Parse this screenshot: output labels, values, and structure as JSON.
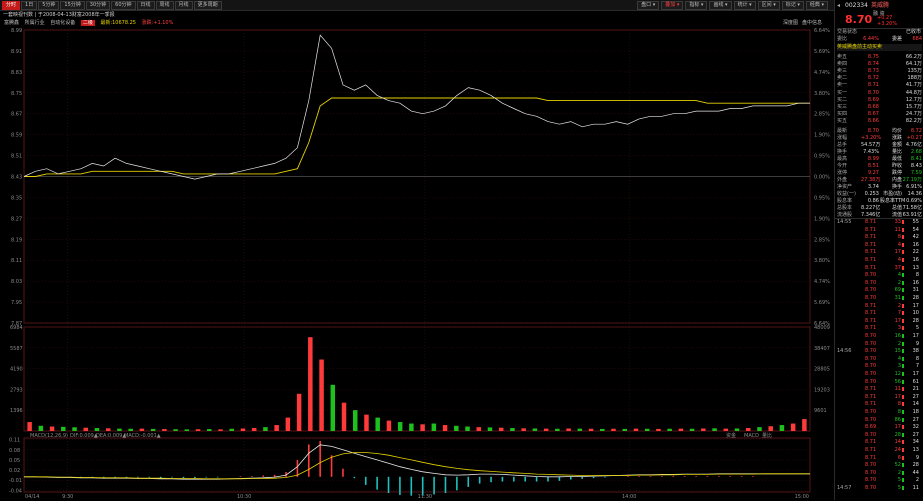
{
  "toolbar": {
    "left": [
      "分时",
      "1日",
      "5分钟",
      "15分钟",
      "30分钟",
      "60分钟",
      "日线",
      "周线",
      "月线",
      "更多周期"
    ],
    "right": [
      "盘口",
      "叠加",
      "指标",
      "画线",
      "统计",
      "区间",
      "标记",
      "经典"
    ]
  },
  "title": "一套映视刊数 | 于2008-04-13财富2008年一季报",
  "info": {
    "left1": "富腾鑫",
    "left2": "所属行业",
    "left3": "自动化设备",
    "tag": "二级",
    "amount": "最新:10678.25",
    "change": "涨跌:+1.10%",
    "right1": "深度图",
    "right2": "盘中信息"
  },
  "chart_data": [
    {
      "type": "line",
      "title": "",
      "time_ticks": [
        "04/14",
        "9:30",
        "10:30",
        "11:30",
        "14:00",
        "15:00"
      ],
      "y_left_ticks": [
        "8.99",
        "8.91",
        "8.83",
        "8.75",
        "8.67",
        "8.59",
        "8.51",
        "8.43",
        "8.35",
        "8.27",
        "8.19",
        "8.11",
        "8.03",
        "7.95",
        "7.87"
      ],
      "y_right_ticks": [
        "6.64%",
        "5.69%",
        "4.74%",
        "3.80%",
        "2.85%",
        "1.90%",
        "0.95%",
        "0.00%",
        "0.95%",
        "1.90%",
        "2.85%",
        "3.80%",
        "4.74%",
        "5.69%",
        "6.64%"
      ],
      "ylim": [
        7.87,
        8.99
      ],
      "prev_close": 8.43,
      "series": [
        {
          "name": "price",
          "values": [
            8.43,
            8.45,
            8.46,
            8.44,
            8.45,
            8.46,
            8.48,
            8.47,
            8.5,
            8.48,
            8.47,
            8.46,
            8.45,
            8.44,
            8.43,
            8.42,
            8.43,
            8.44,
            8.44,
            8.45,
            8.46,
            8.47,
            8.48,
            8.5,
            8.54,
            8.72,
            8.97,
            8.92,
            8.78,
            8.76,
            8.78,
            8.74,
            8.72,
            8.71,
            8.68,
            8.67,
            8.68,
            8.7,
            8.74,
            8.77,
            8.76,
            8.74,
            8.71,
            8.69,
            8.67,
            8.66,
            8.64,
            8.63,
            8.64,
            8.62,
            8.63,
            8.63,
            8.64,
            8.63,
            8.65,
            8.66,
            8.66,
            8.67,
            8.67,
            8.68,
            8.68,
            8.68,
            8.69,
            8.69,
            8.7,
            8.7,
            8.7,
            8.7,
            8.71,
            8.71
          ]
        },
        {
          "name": "average",
          "values": [
            8.43,
            8.43,
            8.44,
            8.44,
            8.44,
            8.44,
            8.45,
            8.45,
            8.45,
            8.45,
            8.45,
            8.45,
            8.45,
            8.45,
            8.44,
            8.44,
            8.44,
            8.44,
            8.44,
            8.44,
            8.44,
            8.44,
            8.44,
            8.45,
            8.46,
            8.56,
            8.7,
            8.73,
            8.73,
            8.73,
            8.73,
            8.73,
            8.73,
            8.73,
            8.73,
            8.73,
            8.73,
            8.73,
            8.73,
            8.73,
            8.73,
            8.73,
            8.73,
            8.73,
            8.73,
            8.73,
            8.72,
            8.72,
            8.72,
            8.72,
            8.72,
            8.72,
            8.72,
            8.72,
            8.72,
            8.72,
            8.72,
            8.72,
            8.72,
            8.72,
            8.71,
            8.71,
            8.71,
            8.71,
            8.71,
            8.71,
            8.71,
            8.71,
            8.71,
            8.71
          ]
        }
      ]
    },
    {
      "type": "bar",
      "title": "",
      "y_left_ticks": [
        "6984",
        "5587",
        "4190",
        "2793",
        "1396"
      ],
      "y_right_ticks": [
        "48009",
        "38407",
        "28805",
        "19203",
        "9601"
      ],
      "ylim": [
        0,
        6984
      ],
      "values": [
        600,
        350,
        300,
        280,
        250,
        220,
        200,
        180,
        160,
        150,
        160,
        140,
        130,
        120,
        110,
        120,
        130,
        110,
        150,
        170,
        200,
        260,
        400,
        900,
        2500,
        6300,
        4800,
        3100,
        1900,
        1400,
        1100,
        900,
        700,
        600,
        500,
        450,
        500,
        400,
        350,
        300,
        260,
        240,
        220,
        200,
        180,
        170,
        160,
        150,
        170,
        160,
        150,
        140,
        150,
        140,
        160,
        150,
        140,
        150,
        160,
        150,
        170,
        180,
        160,
        170,
        200,
        260,
        320,
        400,
        500,
        800
      ],
      "colors": [
        "r",
        "g",
        "r",
        "g",
        "g",
        "r",
        "g",
        "r",
        "g",
        "g",
        "r",
        "g",
        "r",
        "g",
        "g",
        "r",
        "g",
        "r",
        "g",
        "r",
        "r",
        "g",
        "r",
        "r",
        "r",
        "r",
        "r",
        "g",
        "r",
        "g",
        "r",
        "g",
        "r",
        "g",
        "g",
        "r",
        "g",
        "r",
        "g",
        "g",
        "r",
        "g",
        "r",
        "g",
        "r",
        "g",
        "r",
        "g",
        "r",
        "g",
        "r",
        "g",
        "r",
        "g",
        "r",
        "g",
        "r",
        "g",
        "r",
        "g",
        "r",
        "g",
        "r",
        "g",
        "r",
        "g",
        "r",
        "g",
        "r",
        "r"
      ]
    },
    {
      "type": "line",
      "title": "",
      "legend": {
        "name": "MACD(12,26,9)",
        "dif": "DIF:0.009▲",
        "dea": "DEA:0.009▲",
        "macd": "MACD:-0.001▲"
      },
      "subtabs": [
        "资金",
        "MACD",
        "量比"
      ],
      "y_left_ticks": [
        "0.11",
        "0.08",
        "0.05",
        "0.02",
        "-0.01",
        "-0.04"
      ],
      "ylim": [
        -0.045,
        0.115
      ],
      "series": [
        {
          "name": "DIF",
          "values": [
            0,
            0,
            -0.001,
            -0.002,
            -0.002,
            -0.003,
            -0.003,
            -0.004,
            -0.004,
            -0.004,
            -0.005,
            -0.005,
            -0.006,
            -0.006,
            -0.007,
            -0.007,
            -0.007,
            -0.007,
            -0.006,
            -0.005,
            -0.004,
            -0.003,
            -0.001,
            0.005,
            0.03,
            0.07,
            0.095,
            0.09,
            0.08,
            0.07,
            0.06,
            0.05,
            0.04,
            0.03,
            0.022,
            0.015,
            0.01,
            0.006,
            0.005,
            0.006,
            0.008,
            0.008,
            0.007,
            0.005,
            0.003,
            0.001,
            0.0,
            0.0,
            0.001,
            0.001,
            0.002,
            0.003,
            0.004,
            0.005,
            0.006,
            0.006,
            0.007,
            0.007,
            0.008,
            0.008,
            0.008,
            0.009,
            0.009,
            0.009,
            0.009,
            0.009,
            0.009,
            0.009,
            0.009,
            0.009
          ]
        },
        {
          "name": "DEA",
          "values": [
            0,
            0,
            0,
            -0.001,
            -0.001,
            -0.002,
            -0.002,
            -0.003,
            -0.003,
            -0.003,
            -0.004,
            -0.004,
            -0.004,
            -0.005,
            -0.005,
            -0.005,
            -0.006,
            -0.006,
            -0.006,
            -0.006,
            -0.005,
            -0.005,
            -0.004,
            -0.002,
            0.005,
            0.022,
            0.042,
            0.058,
            0.068,
            0.072,
            0.072,
            0.069,
            0.064,
            0.057,
            0.05,
            0.043,
            0.036,
            0.03,
            0.025,
            0.021,
            0.018,
            0.016,
            0.014,
            0.012,
            0.01,
            0.008,
            0.007,
            0.006,
            0.005,
            0.004,
            0.004,
            0.004,
            0.004,
            0.004,
            0.005,
            0.005,
            0.006,
            0.006,
            0.007,
            0.007,
            0.007,
            0.008,
            0.008,
            0.008,
            0.008,
            0.009,
            0.009,
            0.009,
            0.009,
            0.009
          ]
        }
      ]
    }
  ],
  "panel": {
    "code": "002334",
    "name": "英威腾",
    "sub": "融 资",
    "price": "8.70",
    "change": "+0.27",
    "pct": "+3.20%",
    "tabs": [
      "交易状态",
      "已收市"
    ],
    "weibi": {
      "l": "委比",
      "v": "6.44%",
      "l2": "委差",
      "v2": "684"
    },
    "sect1": "英威腾盘前主动买卖",
    "asks": [
      {
        "l": "卖五",
        "p": "8.75",
        "v": "66.2万"
      },
      {
        "l": "卖四",
        "p": "8.74",
        "v": "64.1万"
      },
      {
        "l": "卖三",
        "p": "8.73",
        "v": "135万"
      },
      {
        "l": "卖二",
        "p": "8.72",
        "v": "188万"
      },
      {
        "l": "卖一",
        "p": "8.71",
        "v": "41.7万"
      }
    ],
    "bids": [
      {
        "l": "买一",
        "p": "8.70",
        "v": "44.8万"
      },
      {
        "l": "买二",
        "p": "8.69",
        "v": "12.7万"
      },
      {
        "l": "买三",
        "p": "8.68",
        "v": "15.7万"
      },
      {
        "l": "买四",
        "p": "8.67",
        "v": "24.7万"
      },
      {
        "l": "买五",
        "p": "8.66",
        "v": "82.2万"
      }
    ],
    "stats": [
      {
        "a": "最新",
        "av": "8.70",
        "b": "均价",
        "bv": "8.72"
      },
      {
        "a": "涨幅",
        "av": "+3.20%",
        "b": "涨跌",
        "bv": "+0.27"
      },
      {
        "a": "总手",
        "av": "54.57万",
        "b": "金额",
        "bv": "4.76亿"
      },
      {
        "a": "换手",
        "av": "7.43%",
        "b": "量比",
        "bv": "2.68"
      },
      {
        "a": "最高",
        "av": "8.99",
        "b": "最低",
        "bv": "8.41"
      },
      {
        "a": "今开",
        "av": "8.51",
        "b": "昨收",
        "bv": "8.43"
      },
      {
        "a": "涨停",
        "av": "9.27",
        "b": "跌停",
        "bv": "7.59"
      },
      {
        "a": "外盘",
        "av": "27.38万",
        "b": "内盘",
        "bv": "27.19万"
      },
      {
        "a": "净资产",
        "av": "3.74",
        "b": "换手",
        "bv": "6.91%"
      },
      {
        "a": "收益(一)",
        "av": "0.253",
        "b": "市盈(动)",
        "bv": "14.36"
      },
      {
        "a": "股息率",
        "av": "0.86",
        "b": "股息率TTM",
        "bv": "0.69%"
      },
      {
        "a": "总股本",
        "av": "8.227亿",
        "b": "总值",
        "bv": "71.58亿"
      },
      {
        "a": "流通股",
        "av": "7.346亿",
        "b": "流值",
        "bv": "63.91亿"
      }
    ],
    "ticks": [
      {
        "t": "14:55",
        "p": "8.71",
        "v": "33",
        "n": "55",
        "c": "r"
      },
      {
        "t": "",
        "p": "8.71",
        "v": "11",
        "n": "54",
        "c": "r"
      },
      {
        "t": "",
        "p": "8.71",
        "v": "8",
        "n": "42",
        "c": "r"
      },
      {
        "t": "",
        "p": "8.71",
        "v": "4",
        "n": "16",
        "c": "r"
      },
      {
        "t": "",
        "p": "8.71",
        "v": "17",
        "n": "22",
        "c": "r"
      },
      {
        "t": "",
        "p": "8.71",
        "v": "4",
        "n": "16",
        "c": "r"
      },
      {
        "t": "",
        "p": "8.71",
        "v": "37",
        "n": "13",
        "c": "r"
      },
      {
        "t": "",
        "p": "8.70",
        "v": "4",
        "n": "8",
        "c": "g"
      },
      {
        "t": "",
        "p": "8.70",
        "v": "2",
        "n": "16",
        "c": "g"
      },
      {
        "t": "",
        "p": "8.70",
        "v": "69",
        "n": "31",
        "c": "g"
      },
      {
        "t": "",
        "p": "8.70",
        "v": "31",
        "n": "28",
        "c": "g"
      },
      {
        "t": "",
        "p": "8.71",
        "v": "2",
        "n": "17",
        "c": "r"
      },
      {
        "t": "",
        "p": "8.71",
        "v": "7",
        "n": "10",
        "c": "r"
      },
      {
        "t": "",
        "p": "8.71",
        "v": "17",
        "n": "28",
        "c": "r"
      },
      {
        "t": "",
        "p": "8.71",
        "v": "3",
        "n": "5",
        "c": "r"
      },
      {
        "t": "",
        "p": "8.70",
        "v": "16",
        "n": "17",
        "c": "g"
      },
      {
        "t": "",
        "p": "8.70",
        "v": "2",
        "n": "9",
        "c": "g"
      },
      {
        "t": "14:56",
        "p": "8.70",
        "v": "15",
        "n": "38",
        "c": "g"
      },
      {
        "t": "",
        "p": "8.70",
        "v": "4",
        "n": "8",
        "c": "g"
      },
      {
        "t": "",
        "p": "8.70",
        "v": "3",
        "n": "7",
        "c": "g"
      },
      {
        "t": "",
        "p": "8.70",
        "v": "12",
        "n": "17",
        "c": "g"
      },
      {
        "t": "",
        "p": "8.70",
        "v": "56",
        "n": "61",
        "c": "g"
      },
      {
        "t": "",
        "p": "8.71",
        "v": "11",
        "n": "21",
        "c": "r"
      },
      {
        "t": "",
        "p": "8.71",
        "v": "17",
        "n": "27",
        "c": "r"
      },
      {
        "t": "",
        "p": "8.71",
        "v": "8",
        "n": "14",
        "c": "r"
      },
      {
        "t": "",
        "p": "8.70",
        "v": "8",
        "n": "18",
        "c": "g"
      },
      {
        "t": "",
        "p": "8.70",
        "v": "86",
        "n": "27",
        "c": "g"
      },
      {
        "t": "",
        "p": "8.69",
        "v": "17",
        "n": "32",
        "c": "r"
      },
      {
        "t": "",
        "p": "8.70",
        "v": "28",
        "n": "27",
        "c": "g"
      },
      {
        "t": "",
        "p": "8.71",
        "v": "14",
        "n": "34",
        "c": "r"
      },
      {
        "t": "",
        "p": "8.71",
        "v": "24",
        "n": "13",
        "c": "r"
      },
      {
        "t": "",
        "p": "8.71",
        "v": "6",
        "n": "9",
        "c": "r"
      },
      {
        "t": "",
        "p": "8.70",
        "v": "52",
        "n": "28",
        "c": "g"
      },
      {
        "t": "",
        "p": "8.70",
        "v": "2",
        "n": "44",
        "c": "g"
      },
      {
        "t": "",
        "p": "8.70",
        "v": "5",
        "n": "2",
        "c": "g"
      },
      {
        "t": "14:57",
        "p": "8.70",
        "v": "5",
        "n": "11",
        "c": "g"
      }
    ]
  }
}
